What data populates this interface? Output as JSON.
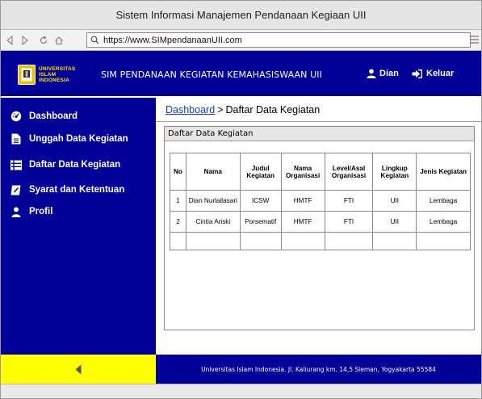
{
  "window": {
    "title": "Sistem Informasi Manajemen Pendanaan Kegiaan UII"
  },
  "browser": {
    "url": "https://www.SIMpendanaanUII.com"
  },
  "header": {
    "logo_text": [
      "UNIVERSITAS",
      "ISLAM",
      "INDONESIA"
    ],
    "app_title": "SIM PENDANAAN KEGIATAN KEMAHASISWAAN UII",
    "user_name": "Dian",
    "logout_label": "Keluar"
  },
  "sidebar": {
    "items": [
      {
        "label": "Dashboard",
        "icon": "dashboard-icon"
      },
      {
        "label": "Unggah Data Kegiatan",
        "icon": "document-icon"
      },
      {
        "label": "Daftar Data Kegiatan",
        "icon": "list-icon"
      },
      {
        "label": "Syarat dan Ketentuan",
        "icon": "edit-icon"
      },
      {
        "label": "Profil",
        "icon": "user-icon"
      }
    ]
  },
  "breadcrumb": {
    "link": "Dashboard",
    "separator": ">",
    "current": "Daftar Data Kegiatan"
  },
  "panel": {
    "title": "Daftar Data Kegiatan"
  },
  "table": {
    "headers": [
      "No",
      "Nama",
      "Judul Kegiatan",
      "Nama Organisasi",
      "Level/Asal Organisasi",
      "Lingkup Kegiatan",
      "Jenis Kegiatan"
    ],
    "rows": [
      [
        "1",
        "Dian Nurlailasari",
        "ICSW",
        "HMTF",
        "FTI",
        "UII",
        "Lembaga"
      ],
      [
        "2",
        "Cintia Ariski",
        "Porsematif",
        "HMTF",
        "FTI",
        "UII",
        "Lembaga"
      ]
    ]
  },
  "footer": {
    "text": "Universitas Islam Indonesia. Jl. Kaliurang km. 14,5 Sleman, Yogyakarta 55584"
  },
  "colors": {
    "primary": "#000099",
    "accent": "#ffff00",
    "link": "#1a3fbf"
  }
}
